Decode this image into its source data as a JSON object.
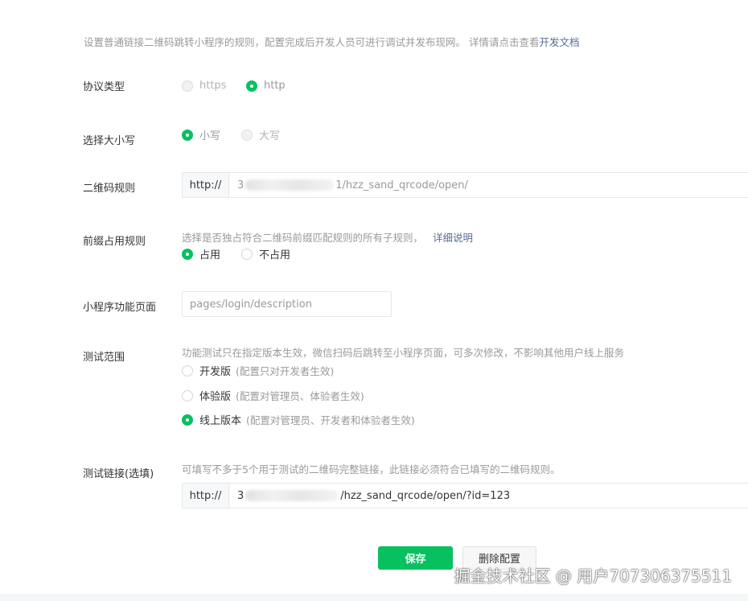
{
  "intro": {
    "text": "设置普通链接二维码跳转小程序的规则，配置完成后开发人员可进行调试并发布现网。 详情请点击查看",
    "link": "开发文档"
  },
  "protocol": {
    "label": "协议类型",
    "options": [
      {
        "label": "https",
        "selected": false,
        "disabled": true
      },
      {
        "label": "http",
        "selected": true,
        "disabled": false
      }
    ]
  },
  "letter_case": {
    "label": "选择大小写",
    "options": [
      {
        "label": "小写",
        "selected": true
      },
      {
        "label": "大写",
        "selected": false
      }
    ]
  },
  "qr_rule": {
    "label": "二维码规则",
    "prefix": "http://",
    "value_start": "3",
    "value_end": "1/hzz_sand_qrcode/open/"
  },
  "prefix_rule": {
    "label": "前缀占用规则",
    "desc": "选择是否独占符合二维码前缀匹配规则的所有子规则，",
    "link": "详细说明",
    "options": [
      {
        "label": "占用",
        "selected": true
      },
      {
        "label": "不占用",
        "selected": false
      }
    ]
  },
  "page_path": {
    "label": "小程序功能页面",
    "value": "pages/login/description"
  },
  "test_scope": {
    "label": "测试范围",
    "desc": "功能测试只在指定版本生效，微信扫码后跳转至小程序页面，可多次修改，不影响其他用户线上服务",
    "options": [
      {
        "label": "开发版",
        "hint": "(配置只对开发者生效)",
        "selected": false
      },
      {
        "label": "体验版",
        "hint": "(配置对管理员、体验者生效)",
        "selected": false
      },
      {
        "label": "线上版本",
        "hint": "(配置对管理员、开发者和体验者生效)",
        "selected": true
      }
    ]
  },
  "test_link": {
    "label": "测试链接(选填)",
    "desc": "可填写不多于5个用于测试的二维码完整链接，此链接必须符合已填写的二维码规则。",
    "prefix": "http://",
    "value_start": "3",
    "value_end": "/hzz_sand_qrcode/open/?id=123"
  },
  "actions": {
    "save": "保存",
    "delete": "删除配置"
  },
  "watermark": "掘金技术社区 @ 用户707306375511",
  "colors": {
    "primary": "#07c160",
    "link": "#576b95",
    "muted": "#9a9a9a"
  }
}
